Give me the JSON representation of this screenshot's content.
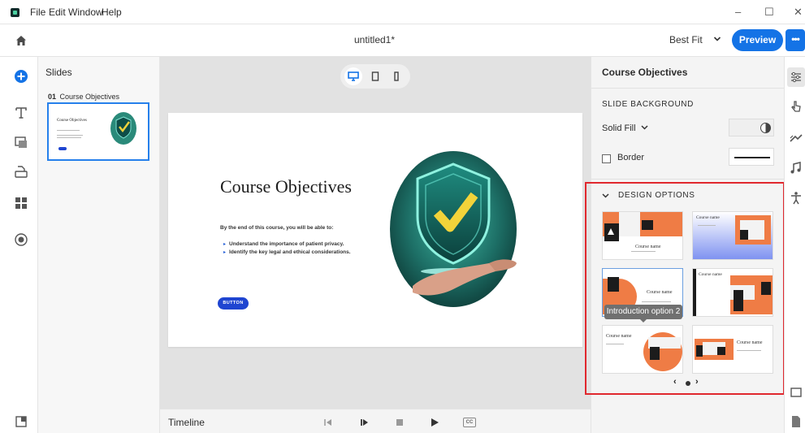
{
  "menubar": {
    "items": [
      "File",
      "Edit",
      "Window",
      "Help"
    ],
    "window_controls": {
      "minimize": "–",
      "maximize": "☐",
      "close": "✕"
    }
  },
  "header": {
    "document_title": "untitled1*",
    "zoom": "Best Fit",
    "preview_label": "Preview",
    "more_label": "•••"
  },
  "left_toolbar": {
    "tools": [
      "home-icon",
      "add-icon",
      "text-icon",
      "media-icon",
      "interactions-icon",
      "widgets-icon",
      "record-icon",
      "panel-toggle-icon"
    ]
  },
  "slides_panel": {
    "title": "Slides",
    "slides": [
      {
        "number": "01",
        "title": "Course Objectives"
      }
    ]
  },
  "canvas": {
    "device_modes": [
      "desktop-icon",
      "tablet-icon",
      "mobile-icon"
    ],
    "active_device": "desktop",
    "slide": {
      "title": "Course Objectives",
      "intro": "By the end of this course, you will be able to:",
      "bullets": [
        "Understand the importance of patient privacy.",
        "Identify the key legal and ethical considerations."
      ],
      "button_label": "BUTTON"
    },
    "thumbnail": {
      "title": "Course Objectives"
    }
  },
  "timeline": {
    "label": "Timeline",
    "cc_label": "CC"
  },
  "properties": {
    "title": "Course Objectives",
    "slide_background_label": "SLIDE BACKGROUND",
    "fill_type": "Solid Fill",
    "border_label": "Border",
    "design_options_label": "DESIGN OPTIONS",
    "layouts": [
      {
        "text": "Course name"
      },
      {
        "text": "Course name"
      },
      {
        "text": "Course name"
      },
      {
        "text": "Course name"
      },
      {
        "text": "Course name"
      },
      {
        "text": "Course name"
      }
    ],
    "tooltip": "Introduction option 2",
    "pager": {
      "prev": "‹",
      "next": "›"
    }
  },
  "colors": {
    "accent_blue": "#1473e6",
    "slide_button": "#1f45d1",
    "layout_orange": "#ef7c45",
    "highlight_red": "#e0282e"
  }
}
